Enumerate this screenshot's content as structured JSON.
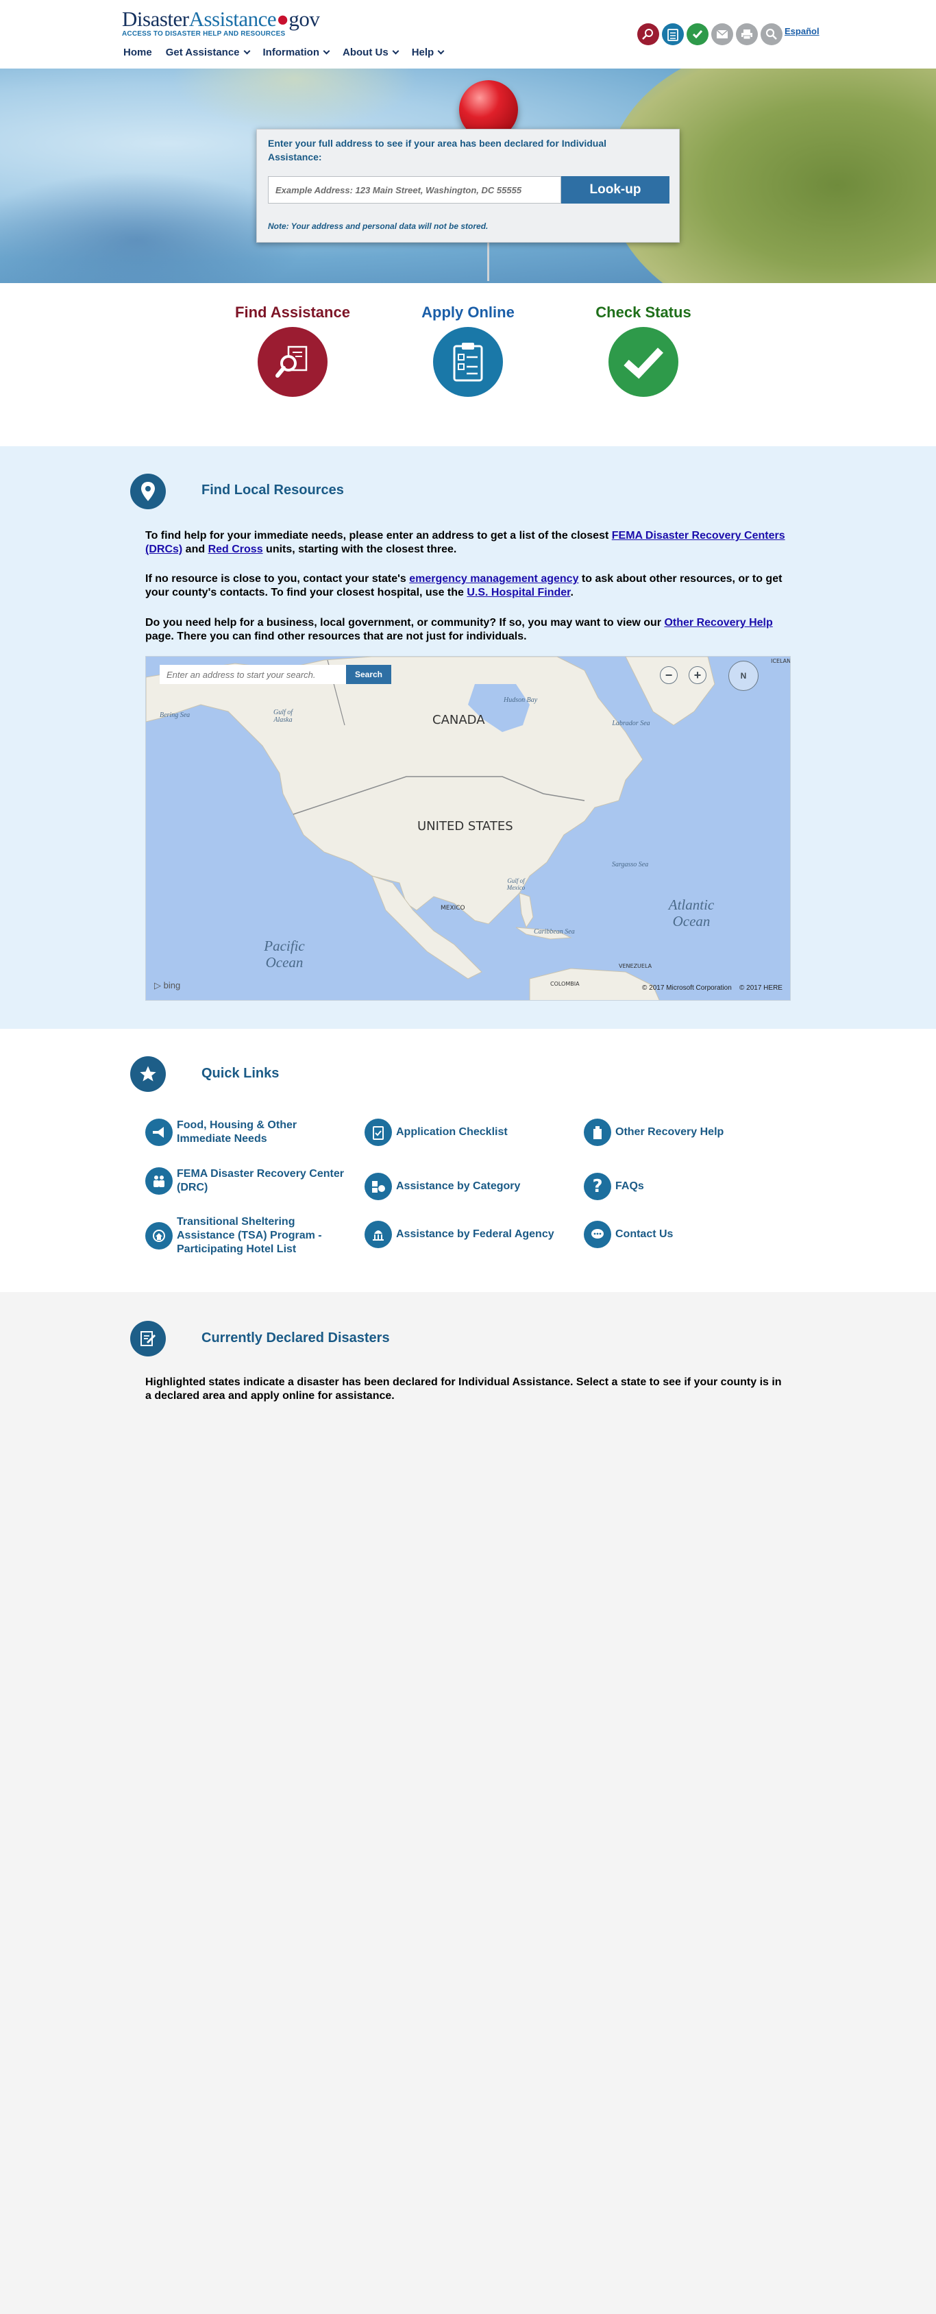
{
  "header": {
    "logo_part1": "Disaster",
    "logo_part2": "Assistance",
    "logo_dot": "●",
    "logo_suffix": "gov",
    "tagline": "ACCESS TO DISASTER HELP AND RESOURCES",
    "espanol": "Español",
    "icons": [
      "find-assistance-icon",
      "apply-online-icon",
      "check-status-icon",
      "email-icon",
      "print-icon",
      "search-icon"
    ]
  },
  "nav": {
    "items": [
      "Home",
      "Get Assistance",
      "Information",
      "About Us",
      "Help"
    ]
  },
  "hero": {
    "prompt": "Enter your full address to see if your area has been declared for Individual Assistance:",
    "placeholder": "Example Address: 123 Main Street, Washington, DC 55555",
    "button": "Look-up",
    "note": "Note: Your address and personal data will not be stored."
  },
  "actions": {
    "find": "Find Assistance",
    "apply": "Apply Online",
    "status": "Check Status",
    "colors": {
      "find": "#9b1c31",
      "apply": "#1a78a8",
      "status": "#2e9a4a"
    }
  },
  "local": {
    "title": "Find Local Resources",
    "p1_a": "To find help for your immediate needs, please enter an address to get a list of the closest ",
    "p1_link1": "FEMA Disaster Recovery Centers (DRCs)",
    "p1_b": " and ",
    "p1_link2": "Red Cross",
    "p1_c": " units, starting with the closest three.",
    "p2_a": "If no resource is close to you, contact your state's ",
    "p2_link1": "emergency management agency",
    "p2_b": " to ask about other resources, or to get your county's contacts. To find your closest hospital, use the ",
    "p2_link2": "U.S. Hospital Finder",
    "p2_c": ".",
    "p3_a": "Do you need help for a business, local government, or community? If so, you may want to view our ",
    "p3_link": "Other Recovery Help",
    "p3_b": " page. There you can find other resources that are not just for individuals.",
    "map": {
      "search_placeholder": "Enter an address to start your search.",
      "search_button": "Search",
      "compass": "N",
      "labels": {
        "canada": "CANADA",
        "us": "UNITED STATES",
        "mexico": "MEXICO",
        "venezuela": "VENEZUELA",
        "colombia": "COLOMBIA",
        "iceland": "ICELAND",
        "bering": "Bering Sea",
        "alaska": "Gulf of Alaska",
        "hudson": "Hudson Bay",
        "labrador": "Labrador Sea",
        "sargasso": "Sargasso Sea",
        "gulf_mexico": "Gulf of Mexico",
        "caribbean": "Caribbean Sea",
        "atlantic": "Atlantic Ocean",
        "pacific": "Pacific Ocean"
      },
      "bing": "bing",
      "credit1": "© 2017 Microsoft Corporation",
      "credit2": "© 2017 HERE"
    }
  },
  "quick": {
    "title": "Quick Links",
    "links": [
      "Food, Housing & Other Immediate Needs",
      "Application Checklist",
      "Other Recovery Help",
      "FEMA Disaster Recovery Center (DRC)",
      "Assistance by Category",
      "FAQs",
      "Transitional Sheltering Assistance (TSA) Program - Participating Hotel List",
      "Assistance by Federal Agency",
      "Contact Us"
    ]
  },
  "declared": {
    "title": "Currently Declared Disasters",
    "text": "Highlighted states indicate a disaster has been declared for Individual Assistance. Select a state to see if your county is in a declared area and apply online for assistance."
  }
}
